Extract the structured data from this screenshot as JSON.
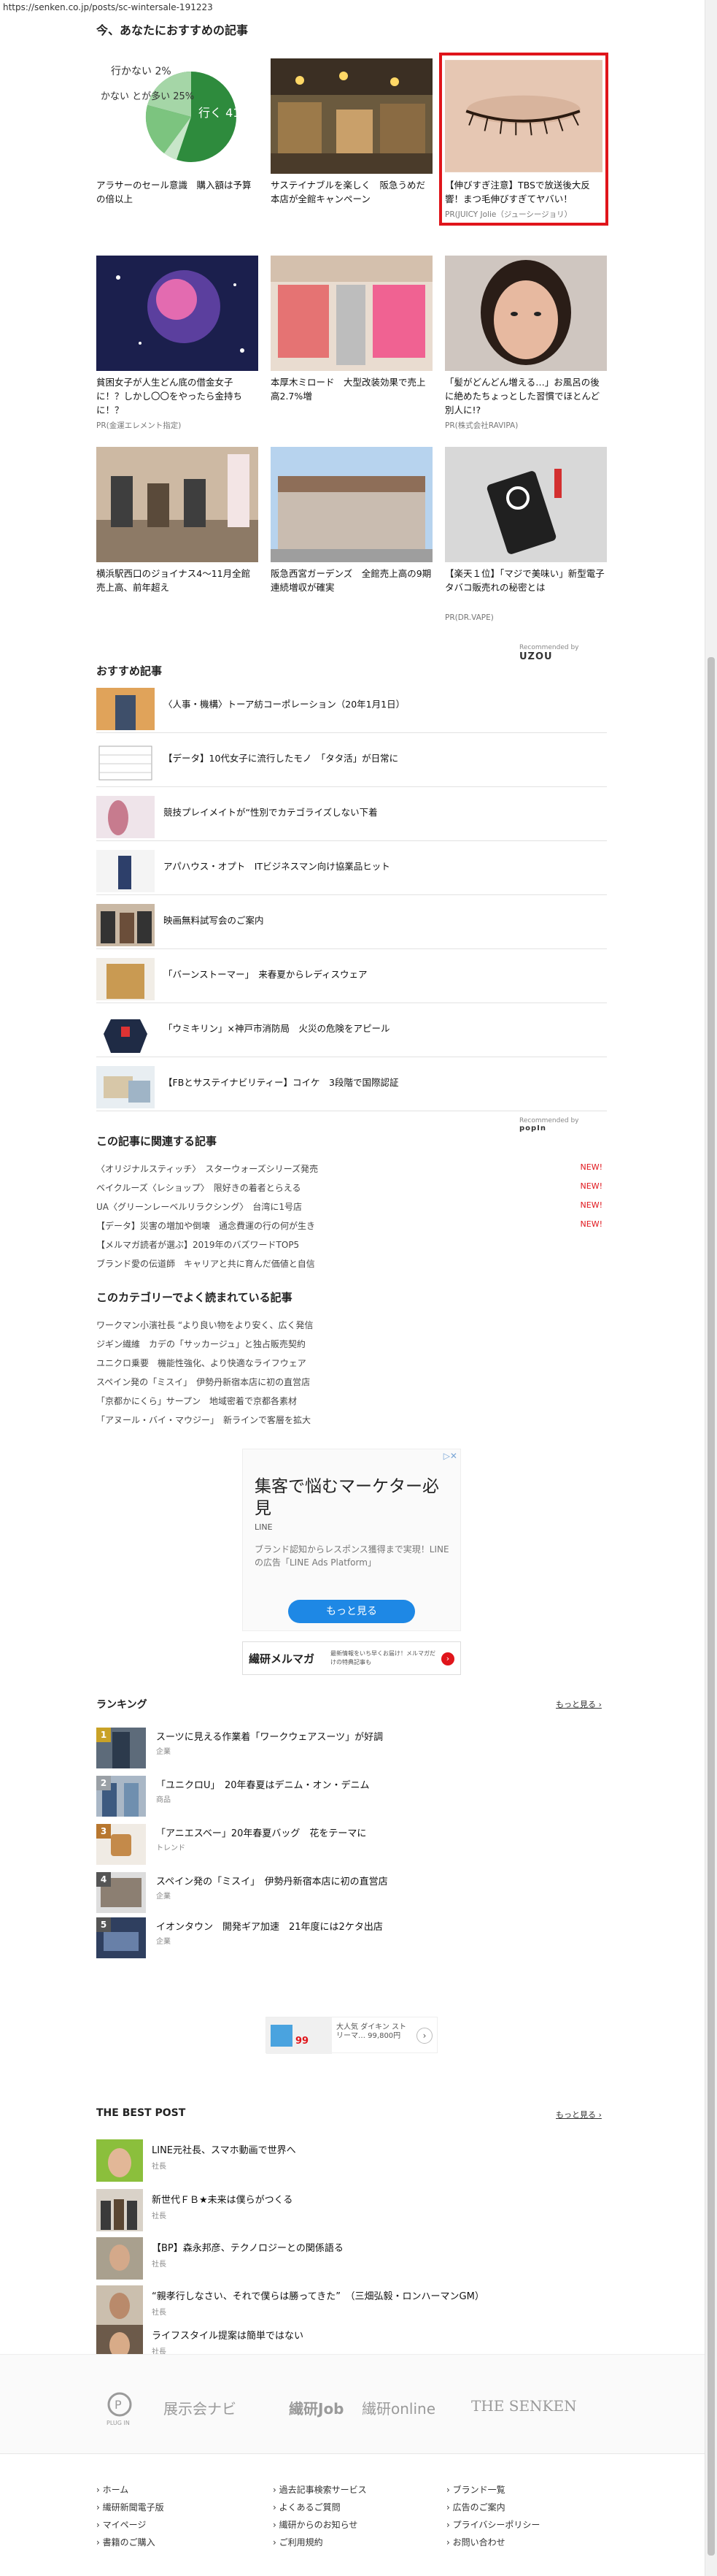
{
  "url": "https://senken.co.jp/posts/sc-wintersale-191223",
  "recommended": {
    "title": "今、あなたにおすすめの記事",
    "pie": {
      "labels": [
        "行かない 2%",
        "かない とが多い 25%",
        "行く 41%"
      ]
    },
    "cards": [
      {
        "title": "アラサーのセール意識　購入額は予算の倍以上",
        "pr": ""
      },
      {
        "title": "サステイナブルを楽しく　阪急うめだ本店が全館キャンペーン",
        "pr": ""
      },
      {
        "title": "【伸びすぎ注意】TBSで放送後大反響！まつ毛伸びすぎてヤバい！",
        "pr": "PR(JUICY Jolie（ジューシージョリ）"
      },
      {
        "title": "貧困女子が人生どん底の借金女子に！？しかし〇〇をやったら金持ちに！？",
        "pr": "PR(金運エレメント指定)"
      },
      {
        "title": "本厚木ミロード　大型改装効果で売上高2.7%増",
        "pr": ""
      },
      {
        "title": "「髪がどんどん増える…」お風呂の後に絶めたちょっとした習慣でほとんど別人に!?",
        "pr": "PR(株式会社RAVIPA)"
      },
      {
        "title": "横浜駅西口のジョイナス4～11月全館売上高、前年超え",
        "pr": ""
      },
      {
        "title": "阪急西宮ガーデンズ　全館売上高の9期連続増収が確実",
        "pr": ""
      },
      {
        "title": "【楽天１位】「マジで美味い」新型電子タバコ販売れの秘密とは",
        "pr": "PR(DR.VAPE)"
      }
    ],
    "credit_label": "Recommended by",
    "credit_brand": "UZOU"
  },
  "osusume": {
    "title": "おすすめ記事",
    "items": [
      "〈人事・機構〉トーア紡コーポレーション（20年1月1日）",
      "【データ】10代女子に流行したモノ　「タタ活」が日常に",
      "競技プレイメイトが“性別でカテゴライズしない下着",
      "アパハウス・オプト　ITビジネスマン向け協業品ヒット",
      "映画無料試写会のご案内",
      "「バーンストーマー」　来春夏からレディスウェア",
      "「ウミキリン」×神戸市消防局　火災の危険をアピール",
      "【FBとサステイナビリティー】コイケ　3段階で国際認証"
    ],
    "credit_label": "Recommended by",
    "credit_brand": "popIn"
  },
  "related": {
    "title": "この記事に関連する記事",
    "items": [
      {
        "text": "〈オリジナルスティッチ〉　スターウォーズシリーズ発売",
        "new": "NEW!"
      },
      {
        "text": "ベイクルーズ〈レショップ〉　限好きの着者とらえる",
        "new": "NEW!"
      },
      {
        "text": "UA〈グリーンレーベルリラクシング〉　台湾に1号店",
        "new": "NEW!"
      },
      {
        "text": "【データ】災害の増加や倒壊　通念費運の行の何が生き",
        "new": "NEW!"
      },
      {
        "text": "【メルマガ読者が選ぶ】2019年のバズワードTOP5",
        "new": ""
      },
      {
        "text": "ブランド愛の伝道師　キャリアと共に育んだ価値と自信",
        "new": ""
      }
    ]
  },
  "category": {
    "title": "このカテゴリーでよく読まれている記事",
    "items": [
      "ワークマン小濱社長 “より良い物をより安く、広く発信",
      "ジギン繊維　カデの「サッカージュ」と独占販売契約",
      "ユニクロ乗要　機能性強化、より快適なライフウェア",
      "スペイン発の「ミスイ」　伊勢丹新宿本店に初の直営店",
      "「京都かにくら」サープン　地域密着で京都各素材",
      "「アヌール・バイ・マウジー」　新ラインで客層を拡大"
    ]
  },
  "ad": {
    "headline": "集客で悩むマーケター必見",
    "brand": "LINE",
    "body": "ブランド認知からレスポンス獲得まで実現！LINEの広告「LINE Ads Platform」",
    "cta": "もっと見る",
    "banner_title": "繊研メルマガ",
    "banner_text": "最新情報をいち早くお届け！メルマガだけの特典記事も"
  },
  "ranking": {
    "title": "ランキング",
    "more": "もっと見る ›",
    "items": [
      {
        "rank": "1",
        "title": "スーツに見える作業着「ワークウェアスーツ」が好調",
        "cat": "企業"
      },
      {
        "rank": "2",
        "title": "「ユニクロU」　20年春夏はデニム・オン・デニム",
        "cat": "商品"
      },
      {
        "rank": "3",
        "title": "「アニエスベー」20年春夏バッグ　花をテーマに",
        "cat": "トレンド"
      },
      {
        "rank": "4",
        "title": "スペイン発の「ミスイ」　伊勢丹新宿本店に初の直営店",
        "cat": "企業"
      },
      {
        "rank": "5",
        "title": "イオンタウン　開発ギア加速　21年度には2ケタ出店",
        "cat": "企業"
      }
    ],
    "mini_ad": "大人気 ダイキン ストリーマ… 99,800円"
  },
  "best": {
    "title": "THE BEST POST",
    "more": "もっと見る ›",
    "items": [
      {
        "title": "LINE元社長、スマホ動画で世界へ",
        "cat": "社長"
      },
      {
        "title": "新世代ＦＢ★未来は僕らがつくる",
        "cat": "社長"
      },
      {
        "title": "【BP】森永邦彦、テクノロジーとの関係語る",
        "cat": "社長"
      },
      {
        "title": "“親孝行しなさい、それで僕らは勝ってきた”　（三畑弘毅・ロンハーマンGM）",
        "cat": "社長"
      },
      {
        "title": "ライフスタイル提案は簡単ではない",
        "cat": "社長"
      }
    ]
  },
  "footer": {
    "logos": [
      "PLUG IN",
      "展示会ナビ",
      "繊研Job",
      "繊研online",
      "THE SENKEN"
    ],
    "links": [
      [
        "ホーム",
        "繊研新聞電子版",
        "マイページ",
        "書籍のご購入"
      ],
      [
        "過去記事検索サービス",
        "よくあるご質問",
        "繊研からのお知らせ",
        "ご利用規約"
      ],
      [
        "ブランド一覧",
        "広告のご案内",
        "プライバシーポリシー",
        "お問い合わせ"
      ]
    ]
  },
  "colors": {
    "accent_red": "#e0151b",
    "link_blue": "#1e88e5",
    "rank1": "#c9a227",
    "rank2": "#9aa0a6",
    "rank3": "#b8772f",
    "rank_other": "#555555"
  }
}
